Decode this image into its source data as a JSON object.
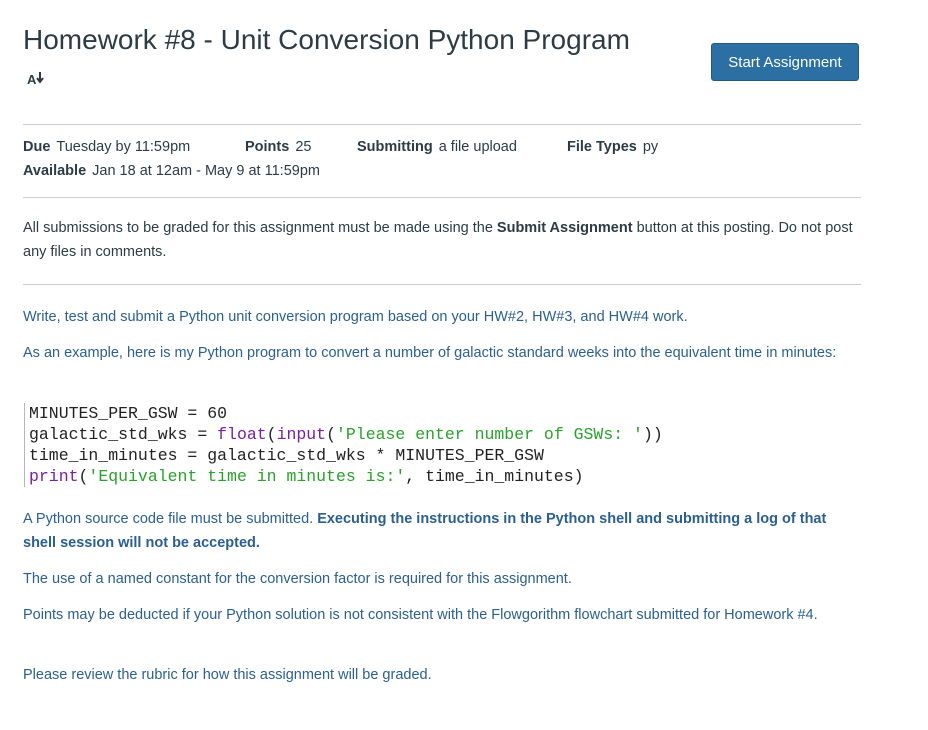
{
  "header": {
    "title": "Homework #8 - Unit Conversion Python Program",
    "start_button": "Start Assignment",
    "accessibility_icon": "ax-icon"
  },
  "details": {
    "due_label": "Due",
    "due_value": "Tuesday by 11:59pm",
    "points_label": "Points",
    "points_value": "25",
    "submitting_label": "Submitting",
    "submitting_value": "a file upload",
    "filetypes_label": "File Types",
    "filetypes_value": "py",
    "available_label": "Available",
    "available_value": "Jan 18 at 12am - May 9 at 11:59pm"
  },
  "notice": {
    "before": "All submissions to be graded for this assignment must be made using the ",
    "bold": "Submit Assignment",
    "after": " button at this posting. Do not post any files in comments."
  },
  "description": {
    "p1": "Write, test and submit a Python unit conversion program based on your HW#2, HW#3, and HW#4 work.",
    "p2": "As an example, here is my Python program to convert a number of galactic standard weeks into the equivalent time in minutes:",
    "code": {
      "line1": "MINUTES_PER_GSW = 60",
      "line2_a": "galactic_std_wks = ",
      "line2_fn1": "float",
      "line2_p1": "(",
      "line2_fn2": "input",
      "line2_p2": "(",
      "line2_str": "'Please enter number of GSWs: '",
      "line2_end": "))",
      "line3": "time_in_minutes = galactic_std_wks * MINUTES_PER_GSW",
      "line4_fn": "print",
      "line4_p": "(",
      "line4_str": "'Equivalent time in minutes is:'",
      "line4_end": ", time_in_minutes)"
    },
    "p3_a": "A Python source code file must be submitted. ",
    "p3_b": "Executing the instructions in the Python shell and submitting a log of that shell session will not be accepted.",
    "p4": "The use of a named constant for the conversion factor is required for this assignment.",
    "p5": "Points may be deducted if your Python solution is not consistent with the Flowgorithm flowchart submitted for Homework #4.",
    "p6": "Please review the rubric for how this assignment will be graded."
  }
}
